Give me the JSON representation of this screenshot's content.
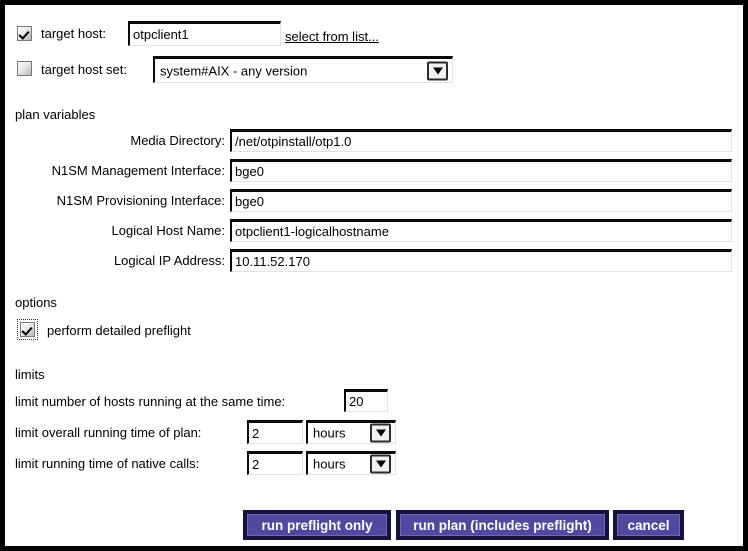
{
  "target": {
    "host": {
      "checkbox_checked": true,
      "label": "target host:",
      "value": "otpclient1",
      "link_label": "select from list..."
    },
    "host_set": {
      "checkbox_checked": false,
      "label": "target host set:",
      "selected": "system#AIX - any version"
    }
  },
  "plan_variables": {
    "title": "plan variables",
    "fields": [
      {
        "label": "Media Directory:",
        "value": "/net/otpinstall/otp1.0"
      },
      {
        "label": "N1SM Management Interface:",
        "value": "bge0"
      },
      {
        "label": "N1SM Provisioning Interface:",
        "value": "bge0"
      },
      {
        "label": "Logical Host Name:",
        "value": "otpclient1-logicalhostname"
      },
      {
        "label": "Logical IP Address:",
        "value": "10.11.52.170"
      }
    ]
  },
  "options": {
    "title": "options",
    "preflight": {
      "label": "perform detailed preflight",
      "checked": true
    }
  },
  "limits": {
    "title": "limits",
    "hosts": {
      "label": "limit number of hosts running at the same time:",
      "value": "20"
    },
    "plan_time": {
      "label": "limit overall running time of plan:",
      "value": "2",
      "unit": "hours"
    },
    "native_time": {
      "label": "limit running time of native calls:",
      "value": "2",
      "unit": "hours"
    }
  },
  "buttons": {
    "run_preflight": "run preflight only",
    "run_plan": "run plan (includes preflight)",
    "cancel": "cancel",
    "accent_color": "#5149a0"
  },
  "icons": {
    "dropdown": "chevron-down-icon"
  }
}
